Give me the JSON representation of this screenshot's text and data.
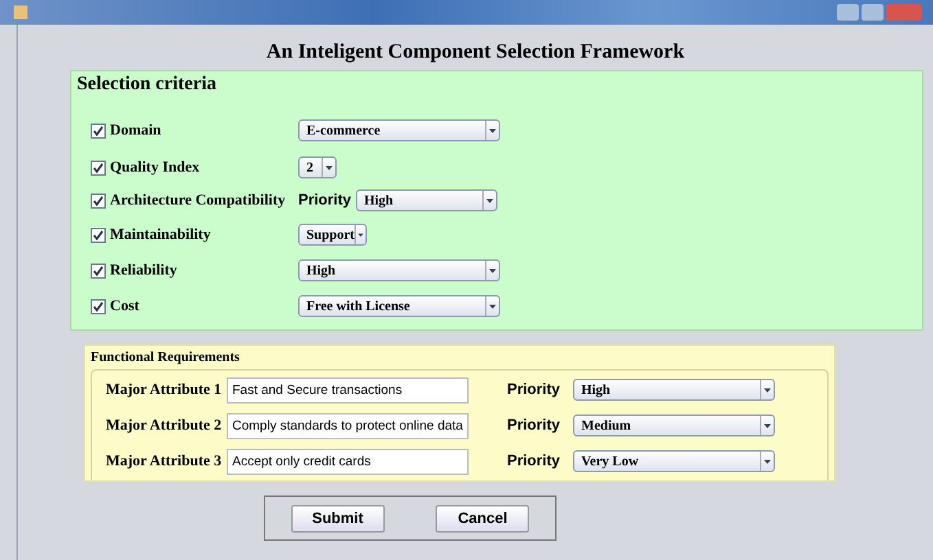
{
  "title": "An Inteligent Component Selection Framework",
  "criteria": {
    "heading": "Selection criteria",
    "rows": [
      {
        "label": "Domain",
        "checked": true,
        "value": "E-commerce"
      },
      {
        "label": "Quality Index",
        "checked": true,
        "value": "2"
      },
      {
        "label": "Architecture Compatibility",
        "checked": true,
        "prefix": "Priority",
        "value": "High"
      },
      {
        "label": "Maintainability",
        "checked": true,
        "value": "Support"
      },
      {
        "label": "Reliability",
        "checked": true,
        "value": "High"
      },
      {
        "label": "Cost",
        "checked": true,
        "value": "Free with License"
      }
    ]
  },
  "functional": {
    "heading": "Functional Requirements",
    "rows": [
      {
        "label": "Major Attribute 1",
        "value": "Fast and Secure transactions",
        "priority_label": "Priority",
        "priority": "High"
      },
      {
        "label": "Major Attribute 2",
        "value": "Comply standards to protect online data",
        "priority_label": "Priority",
        "priority": "Medium"
      },
      {
        "label": "Major Attribute 3",
        "value": "Accept only credit cards",
        "priority_label": "Priority",
        "priority": "Very Low"
      }
    ]
  },
  "buttons": [
    "Submit",
    "Cancel"
  ]
}
